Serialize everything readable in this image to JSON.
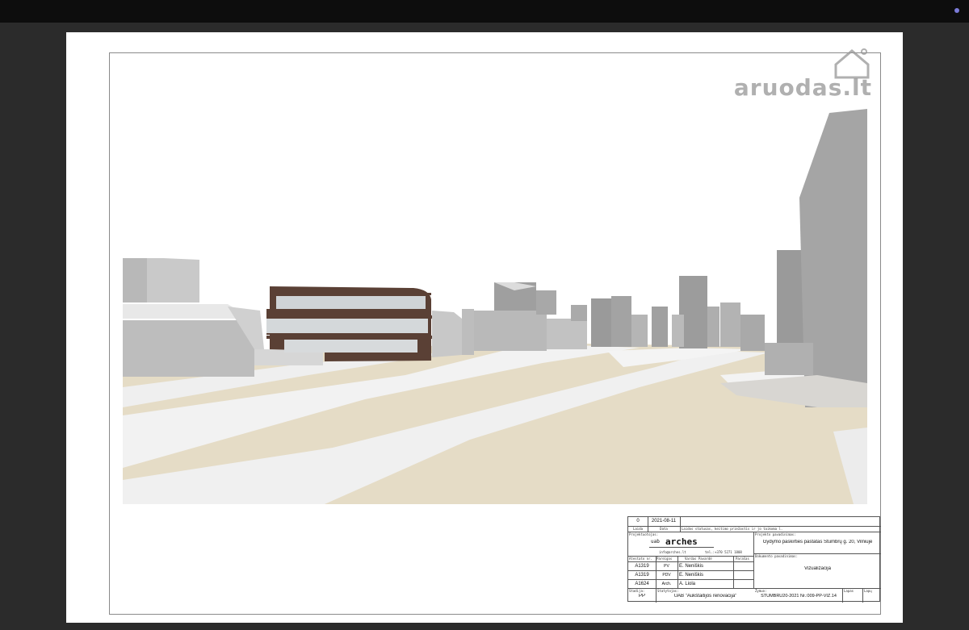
{
  "watermark": {
    "text": "aruodas.lt"
  },
  "title_block": {
    "revision": "0",
    "date": "2021-08-11",
    "hdr_laida": "Laida",
    "hdr_data": "Data",
    "hdr_statusas": "Laidos statusas, keitimo priežastis ir jo taikoma l.",
    "lbl_projektuotojas": "Projektuotojas:",
    "company_prefix": "uab",
    "company_name": "arches",
    "email": "info@arches.lt",
    "phone": "tel.:+370 5271 1808",
    "lbl_project_name": "Projekto pavadinimas:",
    "project_name": "Gydymo paskirties pastatas Stumbrų g. 20, Vilniuje",
    "lbl_doc_name": "Dokumento pavadinimas:",
    "doc_name": "Vizualizacija",
    "staff_headers": [
      "Atestato nr.",
      "Pareigos",
      "Vardas Pavardė",
      "Parašas"
    ],
    "staff": [
      {
        "cert": "A1319",
        "role": "PV",
        "name": "E. Neniškis"
      },
      {
        "cert": "A1319",
        "role": "PDV",
        "name": "E. Neniškis"
      },
      {
        "cert": "A1624",
        "role": "Arch.",
        "name": "A. Liola"
      }
    ],
    "lbl_stage": "Stadija:",
    "stage": "PP",
    "lbl_client": "Statytojas:",
    "client": "UAB \"Aukštaitijos renovacija\"",
    "lbl_code": "Žymuo:",
    "code": "STUMBRU20-2021 Nr.:009-PP-VIZ.14",
    "lbl_lapas": "Lapas",
    "lbl_lapu": "Lapų"
  },
  "colors": {
    "ground": "#e5dcc6",
    "road": "#f2f2f2",
    "building_gray": "#a9a9a9",
    "facade_brown": "#5a4035",
    "background": "#2b2b2b"
  }
}
